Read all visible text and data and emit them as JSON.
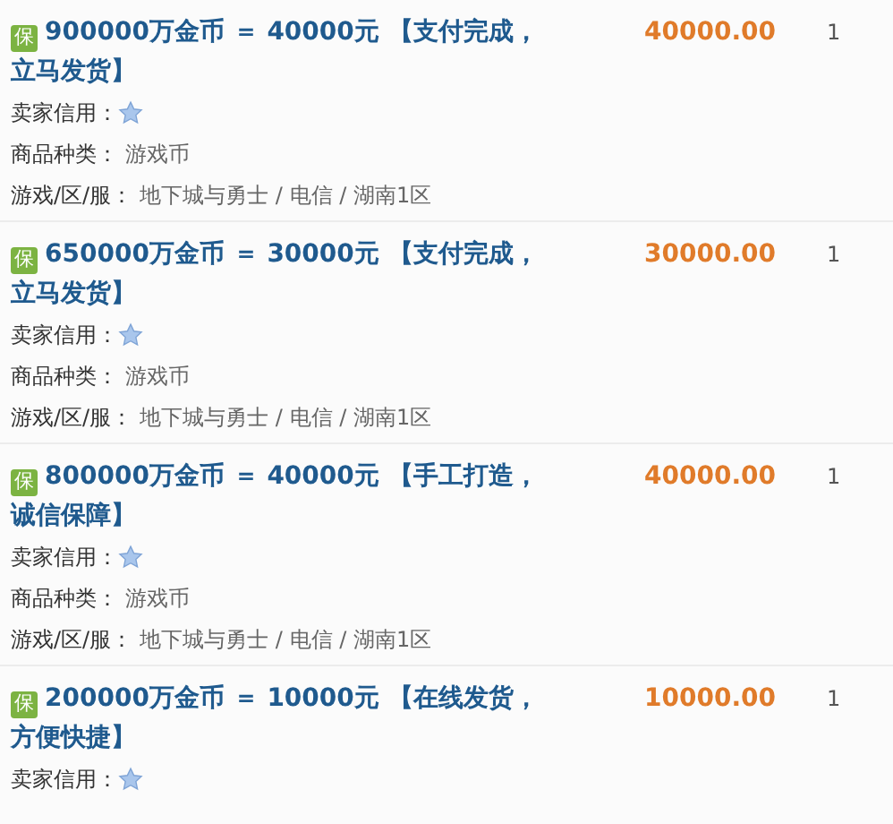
{
  "listings": [
    {
      "badge": "保",
      "title": "900000万金币 ＝ 40000元 【支付完成，立马发货】",
      "seller_credit_label": "卖家信用：",
      "type_label": "商品种类：",
      "type_value": "游戏币",
      "server_label": "游戏/区/服：",
      "server_value": "地下城与勇士 / 电信 / 湖南1区",
      "price": "40000.00",
      "quantity": "1"
    },
    {
      "badge": "保",
      "title": "650000万金币 ＝ 30000元 【支付完成，立马发货】",
      "seller_credit_label": "卖家信用：",
      "type_label": "商品种类：",
      "type_value": "游戏币",
      "server_label": "游戏/区/服：",
      "server_value": "地下城与勇士 / 电信 / 湖南1区",
      "price": "30000.00",
      "quantity": "1"
    },
    {
      "badge": "保",
      "title": "800000万金币 ＝ 40000元 【手工打造，诚信保障】",
      "seller_credit_label": "卖家信用：",
      "type_label": "商品种类：",
      "type_value": "游戏币",
      "server_label": "游戏/区/服：",
      "server_value": "地下城与勇士 / 电信 / 湖南1区",
      "price": "40000.00",
      "quantity": "1"
    },
    {
      "badge": "保",
      "title": "200000万金币 ＝ 10000元 【在线发货，方便快捷】",
      "seller_credit_label": "卖家信用：",
      "price": "10000.00",
      "quantity": "1"
    }
  ]
}
